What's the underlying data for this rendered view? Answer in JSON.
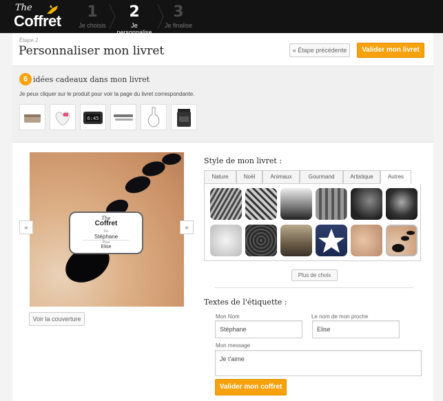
{
  "header": {
    "logo": {
      "the": "The",
      "name": "Coffret"
    },
    "steps": [
      {
        "num": "1",
        "label": "Je choisis"
      },
      {
        "num": "2",
        "label": "Je personnalise"
      },
      {
        "num": "3",
        "label": "Je finalise"
      }
    ]
  },
  "page": {
    "step_small": "Étape 2",
    "title": "Personnaliser mon livret",
    "prev_button": "« Étape précédente",
    "validate_top": "Valider mon livret"
  },
  "ideas": {
    "count": "6",
    "title": "idées cadeaux dans mon livret",
    "subtitle": "Je peux cliquer sur le produit pour voir la page du livret correspondante.",
    "items": [
      "clutch-bag",
      "heart-box",
      "digital-clock",
      "pen-set",
      "carafe",
      "candle-jar"
    ]
  },
  "preview": {
    "label_the": "The",
    "label_coffret": "Coffret",
    "label_de": "De",
    "label_from": "Stéphane",
    "label_pour": "Pour",
    "label_to": "Elise",
    "prev_arrow": "«",
    "next_arrow": "»",
    "cover_button": "Voir la couverture"
  },
  "style": {
    "title": "Style de mon livret :",
    "tabs": [
      "Nature",
      "Noël",
      "Animaux",
      "Gourmand",
      "Artistique",
      "Autres"
    ],
    "active_tab": "Autres",
    "more_button": "Plus de choix"
  },
  "texts": {
    "title": "Textes de l'étiquette :",
    "name_label": "Mon Nom",
    "name_value": "Stéphane",
    "recipient_label": "Le nom de mon proche",
    "recipient_value": "Elise",
    "message_label": "Mon message",
    "message_value": "Je t'aime",
    "validate_bottom": "Valider mon coffret"
  },
  "colors": {
    "accent": "#f7a10d",
    "topbar": "#131313"
  }
}
